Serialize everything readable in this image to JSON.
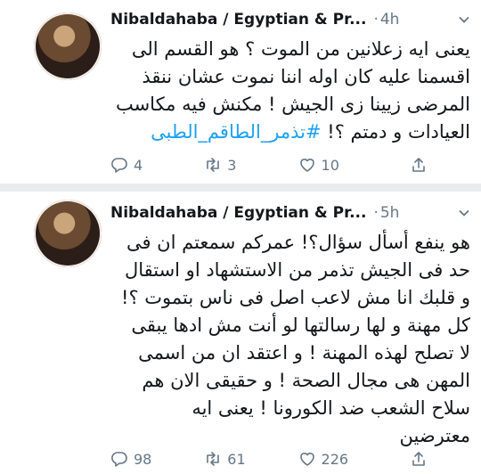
{
  "tweets": [
    {
      "display_name": "Nibaldahaba / Egyptian & Pr...",
      "time": "4h",
      "lines": [
        "يعنى ايه زعلانين من الموت ؟ هو القسم الى",
        "اقسمنا عليه كان اوله اننا نموت عشان ننقذ",
        "المرضى زيينا زى الجيش ! مكنش فيه مكاسب",
        "العيادات و دمتم ؟!"
      ],
      "hashtag": "#تذمر_الطاقم_الطبى",
      "replies": "4",
      "retweets": "3",
      "likes": "10",
      "icons": {
        "reply": "reply-icon",
        "retweet": "retweet-icon",
        "like": "heart-icon",
        "share": "share-icon"
      }
    },
    {
      "display_name": "Nibaldahaba / Egyptian & Pr...",
      "time": "5h",
      "lines": [
        "هو ينفع أسأل سؤال؟! عمركم سمعتم ان فى",
        "حد فى الجيش تذمر من الاستشهاد او استقال",
        "و قلبك انا مش لاعب اصل فى ناس بتموت ؟!",
        "كل مهنة و لها رسالتها لو أنت مش ادها يبقى",
        "لا تصلح لهذه المهنة ! و اعتقد ان من اسمى",
        "المهن هى مجال الصحة ! و حقيقى الان هم",
        "سلاح الشعب ضد الكورونا ! يعنى ايه",
        "معترضين"
      ],
      "replies": "98",
      "retweets": "61",
      "likes": "226",
      "icons": {
        "reply": "reply-icon",
        "retweet": "retweet-icon",
        "like": "heart-icon",
        "share": "share-icon"
      }
    }
  ],
  "colors": {
    "link": "#1da1f2",
    "muted": "#657786",
    "text": "#14171a",
    "separator": "#e9ebee"
  }
}
